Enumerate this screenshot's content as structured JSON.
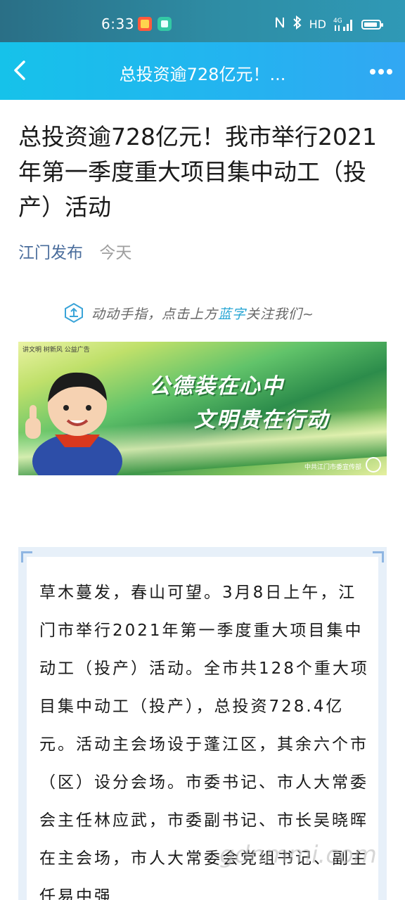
{
  "status_bar": {
    "time": "6:33",
    "icons": [
      "nfc-icon",
      "bluetooth-icon",
      "hd-icon",
      "signal-4g-icon",
      "battery-icon"
    ],
    "hd_label": "HD",
    "network_label": "4G"
  },
  "app_bar": {
    "title": "总投资逾728亿元！...",
    "back_icon": "back-arrow-icon",
    "more_icon": "more-dots-icon"
  },
  "article": {
    "title": "总投资逾728亿元！我市举行2021年第一季度重大项目集中动工（投产）活动",
    "author": "江门发布",
    "date": "今天"
  },
  "follow_banner": {
    "text_prefix": "动动手指，点击上方",
    "highlight": "蓝字",
    "text_suffix": "关注我们~"
  },
  "promo": {
    "top_line": "讲文明 树新风 公益广告",
    "line1": "公德装在心中",
    "line2": "文明贵在行动",
    "footer": "中共江门市委宣传部"
  },
  "body_text": "草木蔓发，春山可望。3月8日上午，江门市举行2021年第一季度重大项目集中动工（投产）活动。全市共128个重大项目集中动工（投产），总投资728.4亿元。活动主会场设于蓬江区，其余六个市（区）设分会场。市委书记、市人大常委会主任林应武，市委副书记、市长吴晓晖在主会场，市人大常委会党组书记、副主任易中强",
  "watermark": "gdnmmi.com",
  "colors": {
    "status_bar": "#2e8da5",
    "app_bar": "#24b3f0",
    "author": "#4a6d9c",
    "quote_bg": "#e7f0f9",
    "accent_blue": "#27a6d4"
  }
}
